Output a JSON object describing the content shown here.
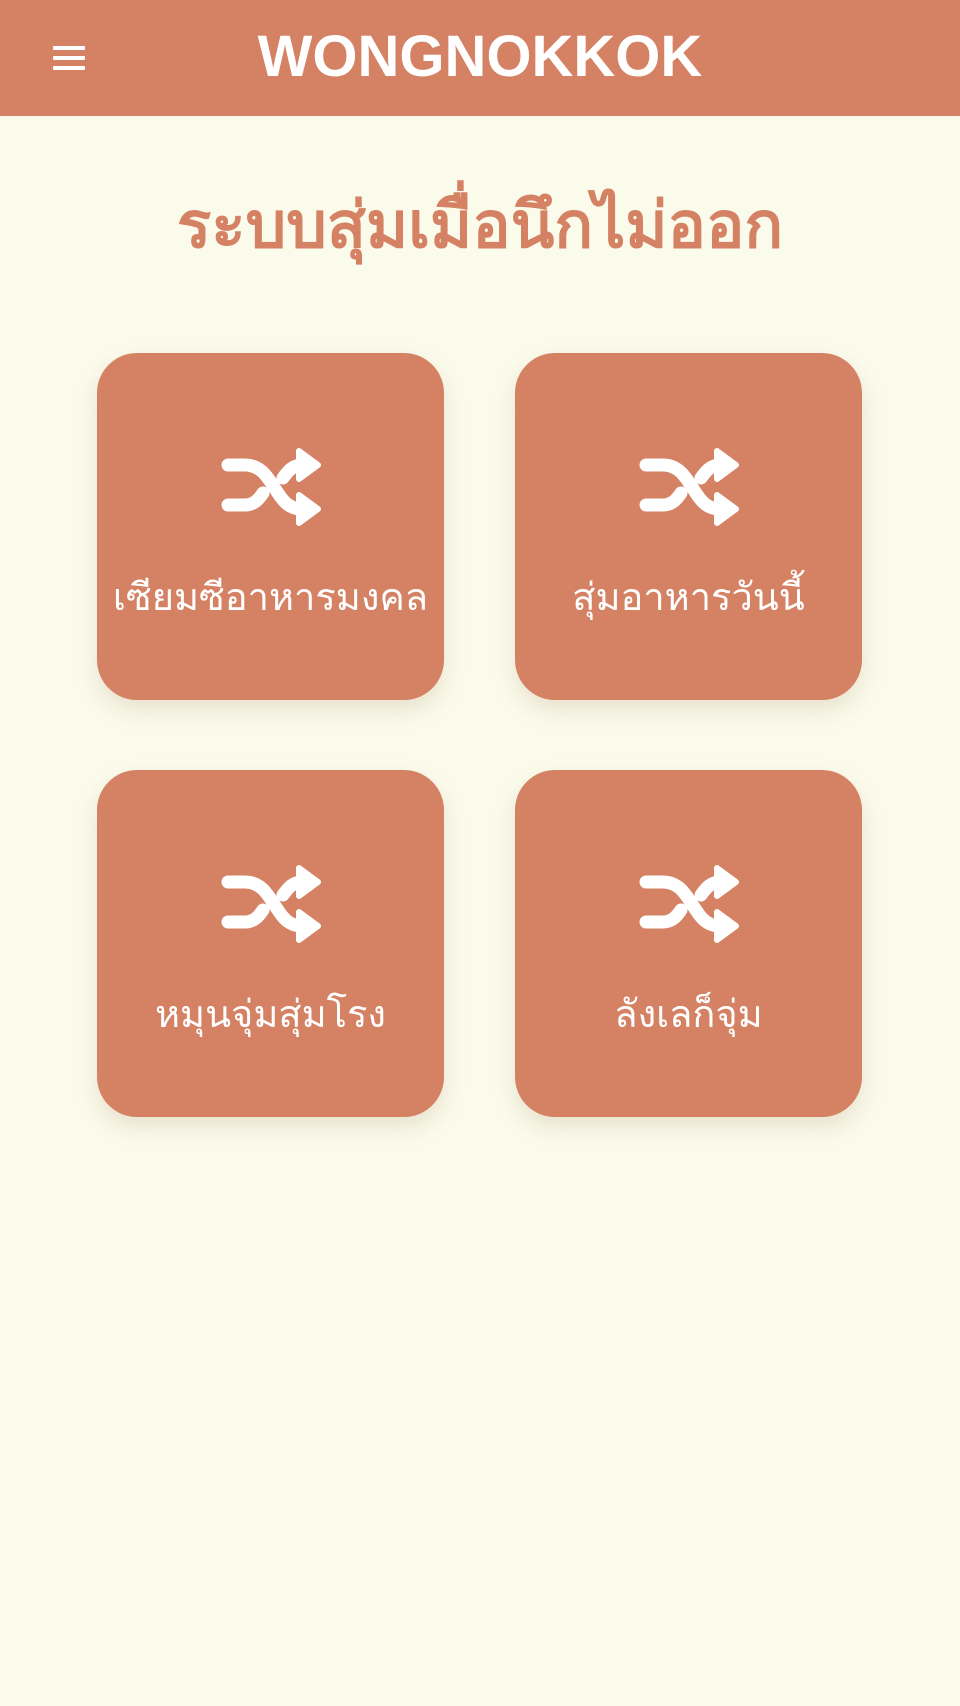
{
  "header": {
    "brand": "WONGNOKKOK",
    "menu_icon": "hamburger-menu-icon"
  },
  "main": {
    "title": "ระบบสุ่มเมื่อนึกไม่ออก",
    "cards": [
      {
        "label": "เซียมซีอาหารมงคล",
        "icon": "shuffle-icon"
      },
      {
        "label": "สุ่มอาหารวันนี้",
        "icon": "shuffle-icon"
      },
      {
        "label": "หมุนจุ่มสุ่มโรง",
        "icon": "shuffle-icon"
      },
      {
        "label": "ลังเลก็จุ่ม",
        "icon": "shuffle-icon"
      }
    ]
  },
  "colors": {
    "accent": "#d58163",
    "background": "#fbfbec",
    "text_on_accent": "#ffffff"
  }
}
